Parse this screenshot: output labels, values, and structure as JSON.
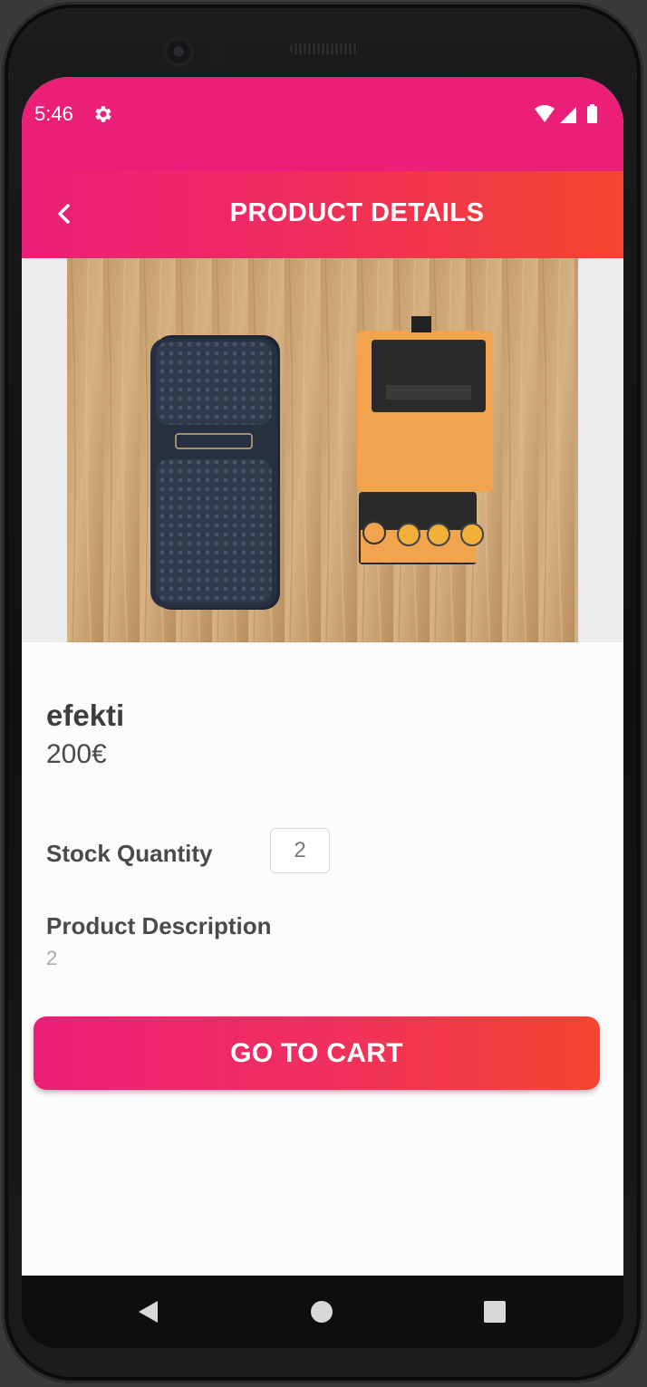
{
  "status_bar": {
    "time": "5:46",
    "icons": [
      "settings-gear-icon",
      "wifi-icon",
      "signal-icon",
      "battery-icon"
    ]
  },
  "app_bar": {
    "title": "PRODUCT DETAILS",
    "back_icon": "chevron-left-icon"
  },
  "product": {
    "image_description": "guitar effect pedals photo",
    "name": "efekti",
    "price": "200€",
    "stock_label": "Stock Quantity",
    "stock_value": "2",
    "description_label": "Product Description",
    "description_value": "2"
  },
  "actions": {
    "cart_button": "GO TO CART"
  },
  "nav_bar": {
    "buttons": [
      "back-triangle-icon",
      "home-circle-icon",
      "recents-square-icon"
    ]
  },
  "colors": {
    "accent_pink": "#ec1f78",
    "accent_orange": "#f5462e",
    "text_dark": "#3e3e3e"
  }
}
